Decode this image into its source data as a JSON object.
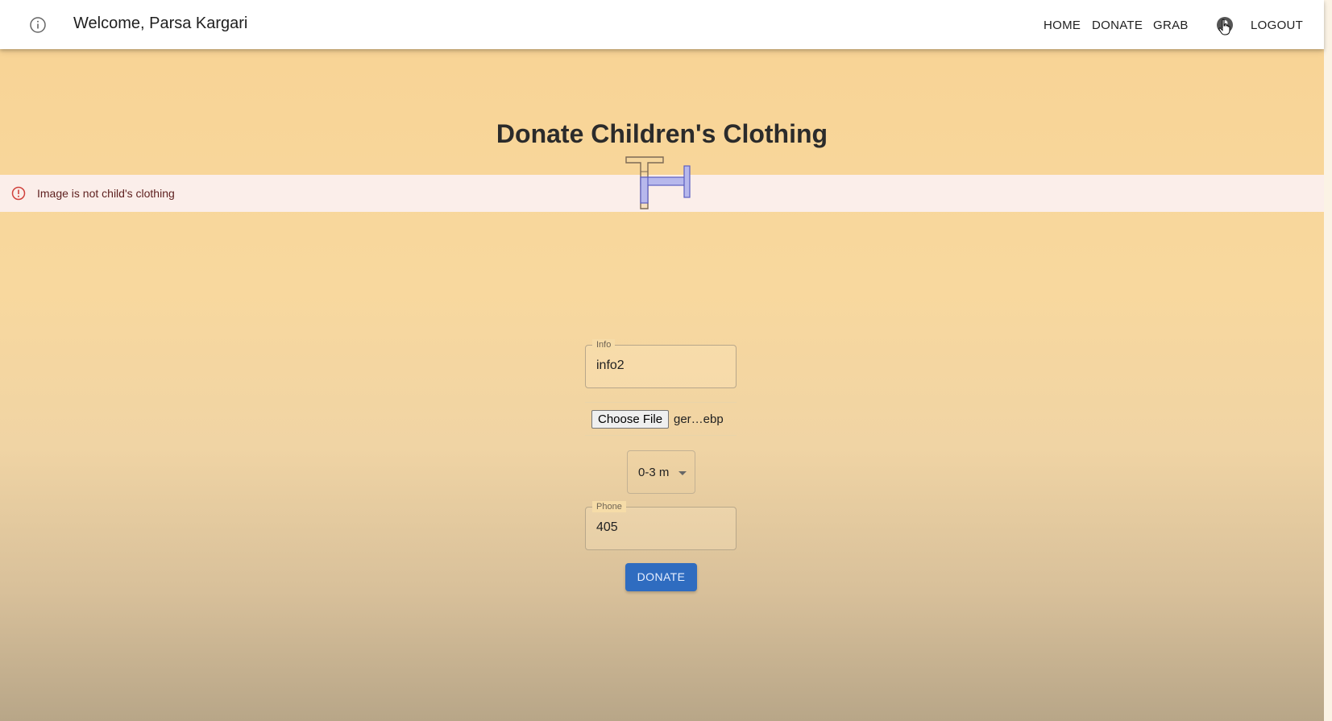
{
  "appbar": {
    "info_icon": "info-circle-icon",
    "welcome_text": "Welcome, Parsa Kargari",
    "nav": {
      "home": "HOME",
      "donate": "DONATE",
      "grab": "GRAB",
      "logout": "LOGOUT"
    },
    "avatar_icon": "account-circle-icon"
  },
  "page_title": "Donate Children's Clothing",
  "alert": {
    "icon": "error-outline-icon",
    "message": "Image is not child's clothing",
    "color": "#fbeeea"
  },
  "form": {
    "info": {
      "label": "Info",
      "value": "info2"
    },
    "file": {
      "button_label": "Choose File",
      "file_name": "ger…ebp"
    },
    "size_select": {
      "value": "0-3 m"
    },
    "phone": {
      "label": "Phone",
      "value": "405"
    },
    "submit_label": "DONATE"
  },
  "colors": {
    "background_top": "#f8d394",
    "background_bottom": "#b8a688",
    "primary_button": "#2f6cc0",
    "alert_text": "#5f2120"
  }
}
